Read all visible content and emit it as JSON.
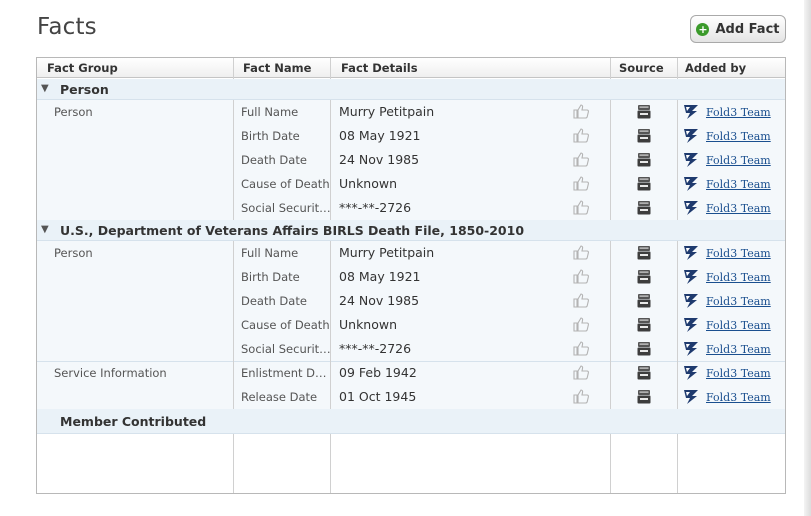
{
  "page": {
    "title": "Facts",
    "add_fact_label": "Add Fact"
  },
  "table": {
    "headers": [
      "Fact Group",
      "Fact Name",
      "Fact Details",
      "Source",
      "Added by"
    ],
    "groups": [
      {
        "title": "Person",
        "subgroups": [
          {
            "name": "Person",
            "facts": [
              {
                "name": "Full Name",
                "details": "Murry Petitpain",
                "added_by": "Fold3 Team"
              },
              {
                "name": "Birth Date",
                "details": "08 May 1921",
                "added_by": "Fold3 Team"
              },
              {
                "name": "Death Date",
                "details": "24 Nov 1985",
                "added_by": "Fold3 Team"
              },
              {
                "name": "Cause of Death",
                "details": "Unknown",
                "added_by": "Fold3 Team"
              },
              {
                "name": "Social Security...",
                "details": "***-**-2726",
                "added_by": "Fold3 Team"
              }
            ]
          }
        ]
      },
      {
        "title": "U.S., Department of Veterans Affairs BIRLS Death File, 1850-2010",
        "subgroups": [
          {
            "name": "Person",
            "facts": [
              {
                "name": "Full Name",
                "details": "Murry Petitpain",
                "added_by": "Fold3 Team"
              },
              {
                "name": "Birth Date",
                "details": "08 May 1921",
                "added_by": "Fold3 Team"
              },
              {
                "name": "Death Date",
                "details": "24 Nov 1985",
                "added_by": "Fold3 Team"
              },
              {
                "name": "Cause of Death",
                "details": "Unknown",
                "added_by": "Fold3 Team"
              },
              {
                "name": "Social Security...",
                "details": "***-**-2726",
                "added_by": "Fold3 Team"
              }
            ]
          },
          {
            "name": "Service Information",
            "facts": [
              {
                "name": "Enlistment Date",
                "details": "09 Feb 1942",
                "added_by": "Fold3 Team"
              },
              {
                "name": "Release Date",
                "details": "01 Oct 1945",
                "added_by": "Fold3 Team"
              }
            ]
          }
        ]
      }
    ],
    "member_contributed_label": "Member Contributed"
  },
  "icons": {
    "expand": "triangle-down-icon",
    "thumb": "thumbs-up-icon",
    "source": "archive-box-icon",
    "added_by_logo": "fold3-logo-icon",
    "add": "plus-circle-icon"
  },
  "colors": {
    "group_bg": "#eaf2f8",
    "link": "#1a4f8f",
    "add_icon": "#3a9a2a"
  }
}
